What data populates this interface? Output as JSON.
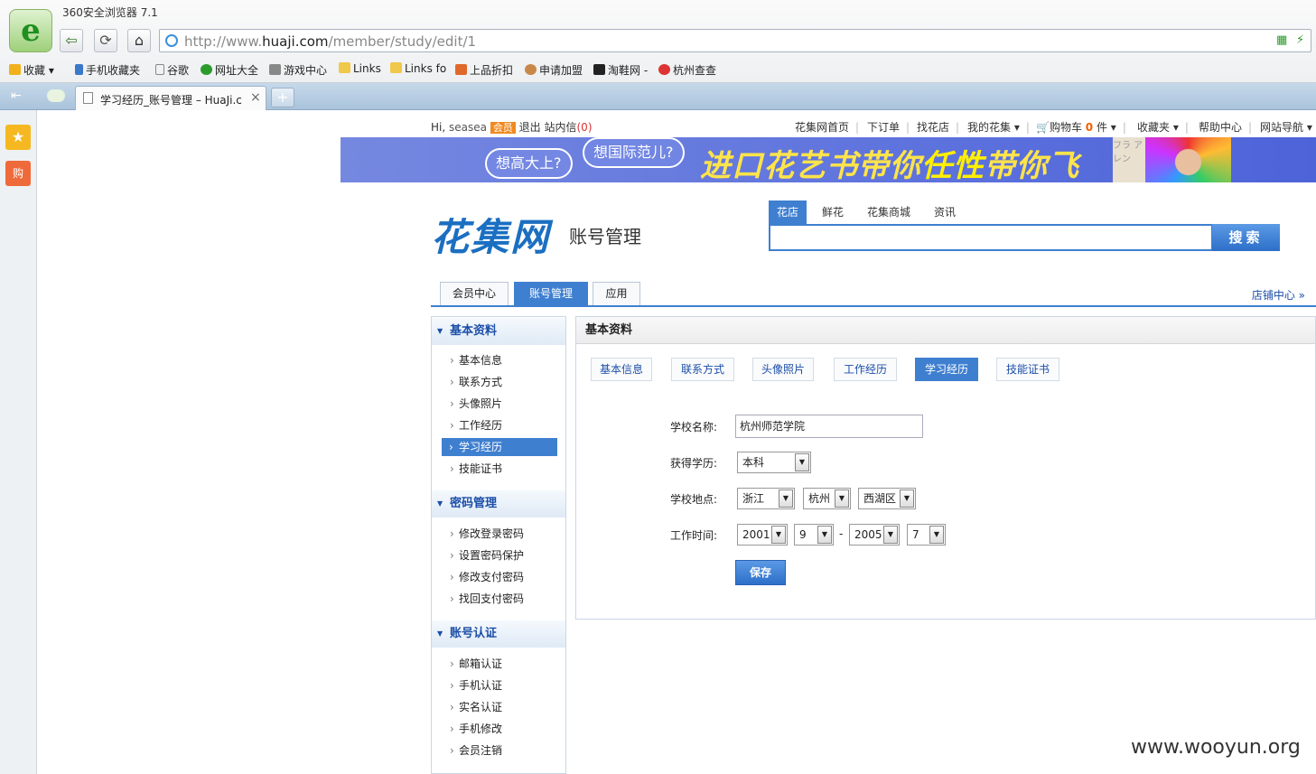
{
  "browser": {
    "title": "360安全浏览器 7.1",
    "url_prefix": "http://www.",
    "url_domain": "huaji.com",
    "url_path": "/member/study/edit/1",
    "bookmarks": [
      "收藏",
      "手机收藏夹",
      "谷歌",
      "网址大全",
      "游戏中心",
      "Links",
      "Links fo",
      "上品折扣",
      "申请加盟",
      "淘鞋网 -",
      "杭州查查"
    ],
    "tab_title": "学习经历_账号管理 – HuaJi.c",
    "tab_close": "×",
    "tab_new": "+"
  },
  "topbar": {
    "hi": "Hi,",
    "username": "seasea",
    "member_badge": "会员",
    "logout": "退出",
    "messages": "站内信",
    "messages_count": "(0)",
    "nav": [
      "花集网首页",
      "下订单",
      "找花店",
      "我的花集 ▾",
      "购物车",
      "帮助中心",
      "网站导航 ▾"
    ],
    "cart_count": "0",
    "cart_unit": "件 ▾",
    "favorites": "收藏夹 ▾"
  },
  "banner": {
    "bubble1": "想高大上?",
    "bubble2": "想国际范儿?",
    "slogan_a": "进口花艺书带你",
    "slogan_b": "任性",
    "slogan_c": "带你飞",
    "pic_text": "フラ アレン"
  },
  "header": {
    "logo": "花集网",
    "subtitle": "账号管理",
    "search_tabs": [
      "花店",
      "鲜花",
      "花集商城",
      "资讯"
    ],
    "search_button": "搜索"
  },
  "main_tabs": [
    "会员中心",
    "账号管理",
    "应用"
  ],
  "shop_center": "店铺中心 »",
  "left_menu": {
    "sections": [
      {
        "title": "基本资料",
        "items": [
          "基本信息",
          "联系方式",
          "头像照片",
          "工作经历",
          "学习经历",
          "技能证书"
        ]
      },
      {
        "title": "密码管理",
        "items": [
          "修改登录密码",
          "设置密码保护",
          "修改支付密码",
          "找回支付密码"
        ]
      },
      {
        "title": "账号认证",
        "items": [
          "邮箱认证",
          "手机认证",
          "实名认证",
          "手机修改",
          "会员注销"
        ]
      }
    ]
  },
  "panel": {
    "title": "基本资料",
    "sub_tabs": [
      "基本信息",
      "联系方式",
      "头像照片",
      "工作经历",
      "学习经历",
      "技能证书"
    ],
    "form": {
      "school_label": "学校名称:",
      "school_value": "杭州师范学院",
      "degree_label": "获得学历:",
      "degree_value": "本科",
      "location_label": "学校地点:",
      "province": "浙江",
      "city": "杭州",
      "district": "西湖区",
      "time_label": "工作时间:",
      "start_year": "2001",
      "start_month": "9",
      "dash": "-",
      "end_year": "2005",
      "end_month": "7",
      "save": "保存"
    }
  },
  "watermark": "www.wooyun.org",
  "colors": {
    "accent": "#3f7fd0",
    "link": "#1b4ea8",
    "banner": "#5d72dd",
    "slogan": "#ffe44a"
  }
}
